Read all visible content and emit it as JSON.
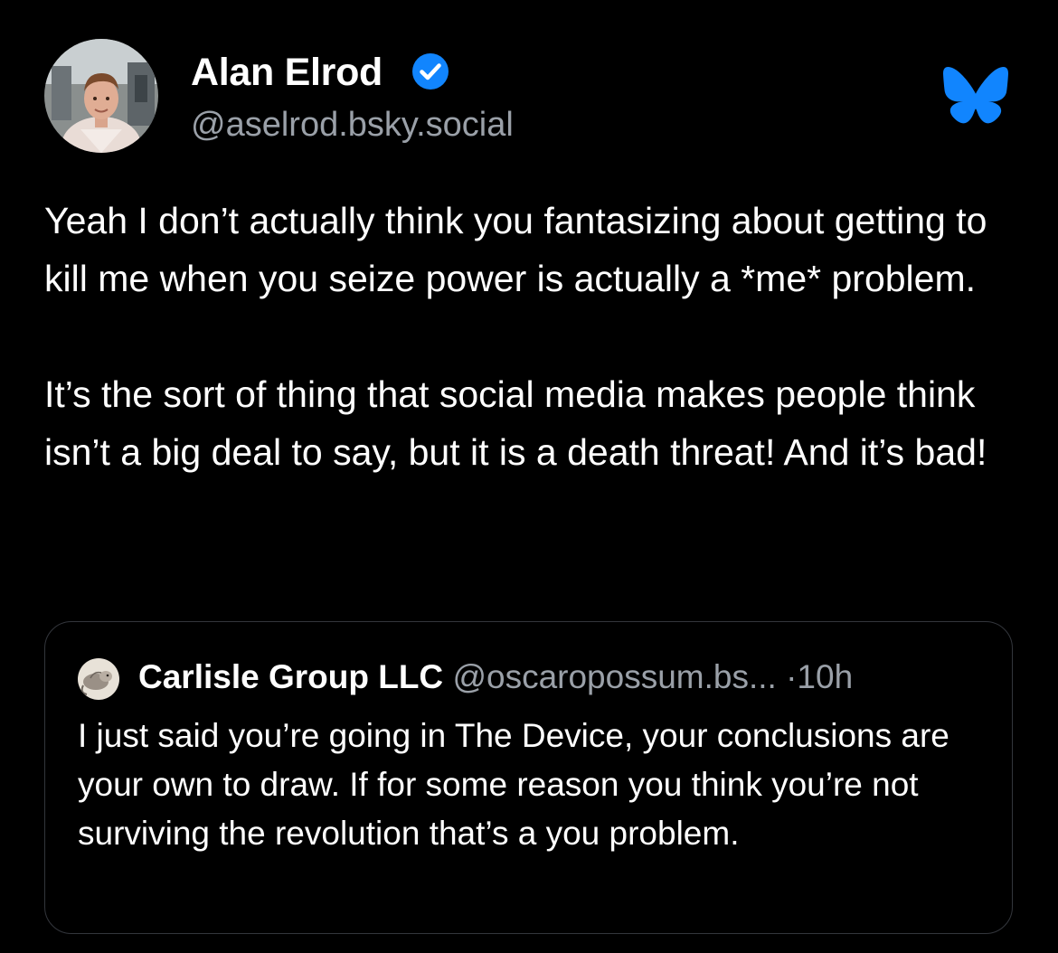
{
  "post": {
    "author": {
      "display_name": "Alan Elrod",
      "handle": "@aselrod.bsky.social",
      "verified": true,
      "avatar_icon": "profile-photo"
    },
    "app_logo_icon": "bluesky-butterfly-icon",
    "text_paragraphs": [
      "Yeah I don’t actually think you fantasizing about getting to kill me when you seize power is actually a *me* problem.",
      "It’s the sort of thing that social media makes people think isn’t a big deal to say, but it is a death threat! And it’s bad!"
    ],
    "quoted": {
      "display_name": "Carlisle Group LLC",
      "handle": "@oscaropossum.bs...",
      "separator": "·",
      "time": "10h",
      "text": "I just said you’re going in The Device, your conclusions are your own to draw. If for some reason you think you’re not surviving the revolution that’s a you problem."
    }
  },
  "colors": {
    "background": "#000000",
    "text": "#ffffff",
    "muted": "#9aa0a8",
    "accent": "#1185fe",
    "border": "#33363c"
  }
}
